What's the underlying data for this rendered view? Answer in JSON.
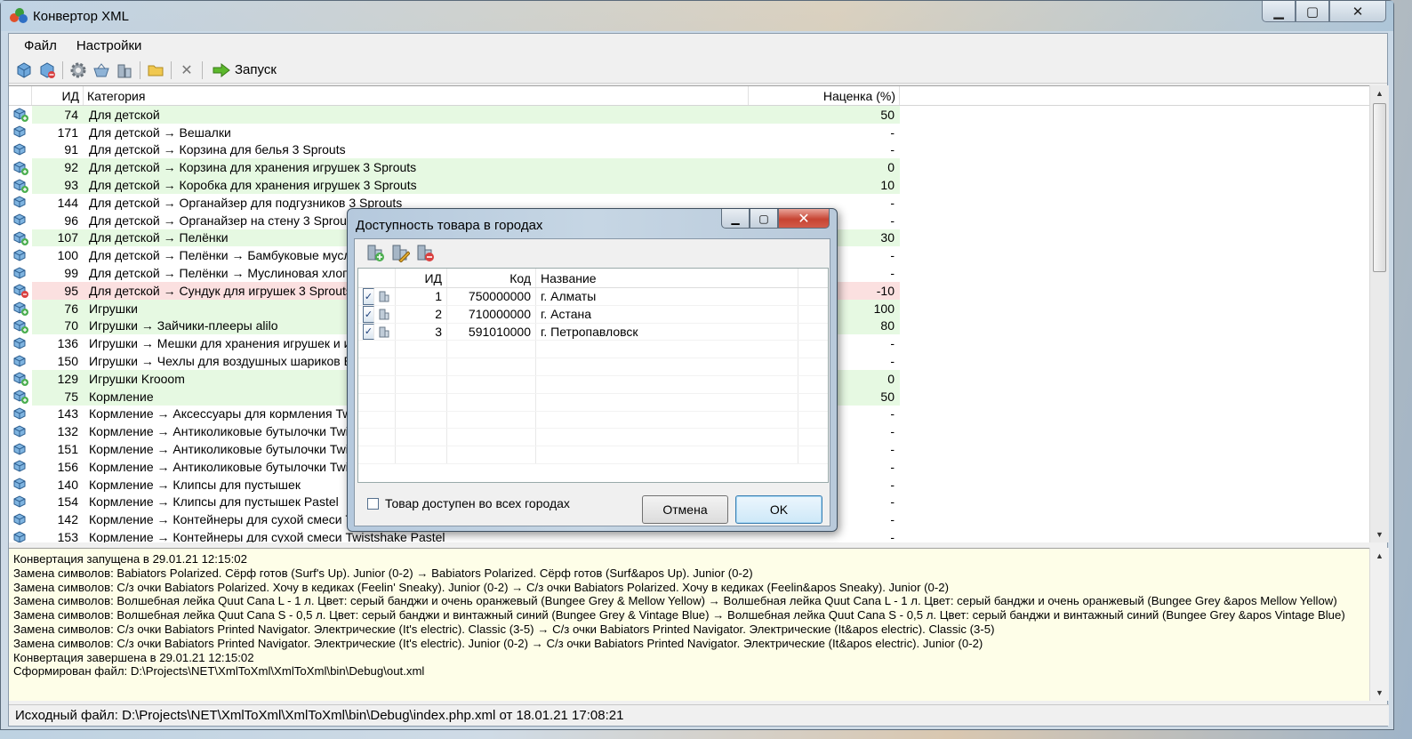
{
  "window": {
    "title": "Конвертор XML"
  },
  "menu": [
    "Файл",
    "Настройки"
  ],
  "toolbar": {
    "run_label": "Запуск"
  },
  "grid": {
    "headers": {
      "id": "ИД",
      "category": "Категория",
      "markup": "Наценка (%)"
    },
    "rows": [
      {
        "id": "74",
        "category": "Для детской",
        "markup": "50",
        "state": "green"
      },
      {
        "id": "171",
        "category": "Для детской → Вешалки",
        "markup": "-",
        "state": ""
      },
      {
        "id": "91",
        "category": "Для детской → Корзина для белья 3 Sprouts",
        "markup": "-",
        "state": ""
      },
      {
        "id": "92",
        "category": "Для детской → Корзина для хранения игрушек 3 Sprouts",
        "markup": "0",
        "state": "green"
      },
      {
        "id": "93",
        "category": "Для детской → Коробка для хранения игрушек 3 Sprouts",
        "markup": "10",
        "state": "green"
      },
      {
        "id": "144",
        "category": "Для детской → Органайзер для подгузников 3 Sprouts",
        "markup": "-",
        "state": ""
      },
      {
        "id": "96",
        "category": "Для детской → Органайзер на стену 3 Sprouts",
        "markup": "-",
        "state": ""
      },
      {
        "id": "107",
        "category": "Для детской → Пелёнки",
        "markup": "30",
        "state": "green"
      },
      {
        "id": "100",
        "category": "Для детской → Пелёнки → Бамбуковые муслиновые",
        "markup": "-",
        "state": ""
      },
      {
        "id": "99",
        "category": "Для детской → Пелёнки → Муслиновая хлопковая",
        "markup": "-",
        "state": ""
      },
      {
        "id": "95",
        "category": "Для детской → Сундук для игрушек 3 Sprouts",
        "markup": "-10",
        "state": "red"
      },
      {
        "id": "76",
        "category": "Игрушки",
        "markup": "100",
        "state": "green"
      },
      {
        "id": "70",
        "category": "Игрушки → Зайчики-плееры alilo",
        "markup": "80",
        "state": "green"
      },
      {
        "id": "136",
        "category": "Игрушки → Мешки для хранения игрушек и игровые коврики",
        "markup": "-",
        "state": ""
      },
      {
        "id": "150",
        "category": "Игрушки → Чехлы для воздушных шариков Bubble",
        "markup": "-",
        "state": ""
      },
      {
        "id": "129",
        "category": "Игрушки Krooom",
        "markup": "0",
        "state": "green"
      },
      {
        "id": "75",
        "category": "Кормление",
        "markup": "50",
        "state": "green"
      },
      {
        "id": "143",
        "category": "Кормление → Аксессуары для кормления Twistshake",
        "markup": "-",
        "state": ""
      },
      {
        "id": "132",
        "category": "Кормление → Антиколиковые бутылочки Twistshake",
        "markup": "-",
        "state": ""
      },
      {
        "id": "151",
        "category": "Кормление → Антиколиковые бутылочки Twistshake Pastel",
        "markup": "-",
        "state": ""
      },
      {
        "id": "156",
        "category": "Кормление → Антиколиковые бутылочки Twistshake Plus",
        "markup": "-",
        "state": ""
      },
      {
        "id": "140",
        "category": "Кормление → Клипсы для пустышек",
        "markup": "-",
        "state": ""
      },
      {
        "id": "154",
        "category": "Кормление → Клипсы для пустышек Pastel",
        "markup": "-",
        "state": ""
      },
      {
        "id": "142",
        "category": "Кормление → Контейнеры для сухой смеси Twistshake",
        "markup": "-",
        "state": ""
      },
      {
        "id": "153",
        "category": "Кормление → Контейнеры для сухой смеси Twistshake Pastel",
        "markup": "-",
        "state": ""
      }
    ]
  },
  "log": [
    "Конвертация запущена в 29.01.21 12:15:02",
    "Замена символов: Babiators Polarized. Сёрф готов (Surf's Up). Junior (0-2) → Babiators Polarized. Сёрф готов (Surf&apos Up). Junior (0-2)",
    "Замена символов: С/з очки Babiators Polarized. Хочу в кедиках (Feelin' Sneaky). Junior (0-2) → С/з очки Babiators Polarized. Хочу в кедиках (Feelin&apos Sneaky). Junior (0-2)",
    "Замена символов: Волшебная лейка Quut Cana L - 1 л. Цвет: серый банджи и очень оранжевый (Bungee Grey & Mellow Yellow) → Волшебная лейка Quut Cana L - 1 л. Цвет: серый банджи и очень оранжевый (Bungee Grey &apos Mellow Yellow)",
    "Замена символов: Волшебная лейка Quut Cana S - 0,5 л. Цвет: серый банджи и винтажный синий (Bungee Grey & Vintage Blue) → Волшебная лейка Quut Cana S - 0,5 л. Цвет: серый банджи и винтажный синий (Bungee Grey &apos Vintage Blue)",
    "Замена символов: С/з очки Babiators Printed Navigator. Электрические (It's electric). Classic (3-5) → С/з очки Babiators Printed Navigator. Электрические (It&apos electric). Classic (3-5)",
    "Замена символов: С/з очки Babiators Printed Navigator. Электрические (It's electric). Junior (0-2) → С/з очки Babiators Printed Navigator. Электрические (It&apos electric). Junior (0-2)",
    "Конвертация завершена в 29.01.21 12:15:02",
    "Сформирован файл: D:\\Projects\\NET\\XmlToXml\\XmlToXml\\bin\\Debug\\out.xml"
  ],
  "status": "Исходный файл: D:\\Projects\\NET\\XmlToXml\\XmlToXml\\bin\\Debug\\index.php.xml от 18.01.21 17:08:21",
  "dialog": {
    "title": "Доступность товара в городах",
    "headers": {
      "id": "ИД",
      "code": "Код",
      "name": "Название"
    },
    "rows": [
      {
        "checked": true,
        "id": "1",
        "code": "750000000",
        "name": "г. Алматы"
      },
      {
        "checked": true,
        "id": "2",
        "code": "710000000",
        "name": "г. Астана"
      },
      {
        "checked": true,
        "id": "3",
        "code": "591010000",
        "name": "г. Петропавловск"
      }
    ],
    "all_cities_label": "Товар доступен во всех городах",
    "cancel_label": "Отмена",
    "ok_label": "OK"
  },
  "colors": {
    "row_green": "#e6f9e2",
    "row_red": "#fbe0e0",
    "log_bg": "#fefee8"
  }
}
